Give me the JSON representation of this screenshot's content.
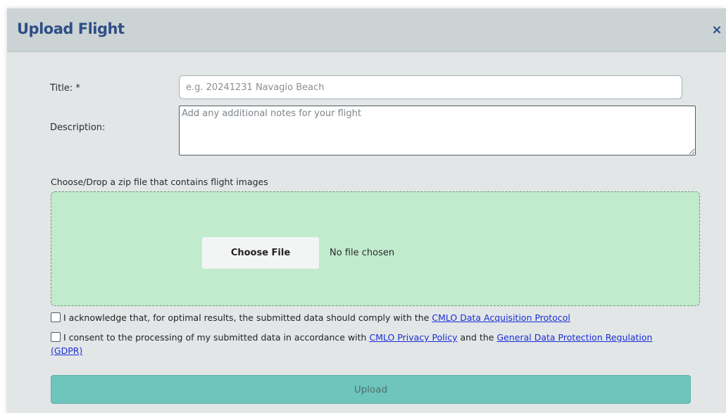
{
  "dialog": {
    "title": "Upload Flight",
    "close_label": "×"
  },
  "form": {
    "title_label": "Title: *",
    "title_placeholder": "e.g. 20241231 Navagio Beach",
    "title_value": "",
    "description_label": "Description:",
    "description_placeholder": "Add any additional notes for your flight",
    "description_value": "",
    "dropzone_label": "Choose/Drop a zip file that contains flight images",
    "choose_file_label": "Choose File",
    "no_file_text": "No file chosen"
  },
  "consents": [
    {
      "checked": false,
      "text_before": "I acknowledge that, for optimal results, the submitted data should comply with the ",
      "link1": "CMLO Data Acquisition Protocol"
    },
    {
      "checked": false,
      "text_before": "I consent to the processing of my submitted data in accordance with ",
      "link1": "CMLO Privacy Policy",
      "text_middle": " and the ",
      "link2": "General Data Protection Regulation (GDPR)"
    }
  ],
  "actions": {
    "upload_label": "Upload"
  },
  "colors": {
    "title": "#2d4f86",
    "dropzone_bg": "#c1ebcd",
    "upload_bg": "#6ec5bc",
    "link": "#1a2fd4"
  }
}
